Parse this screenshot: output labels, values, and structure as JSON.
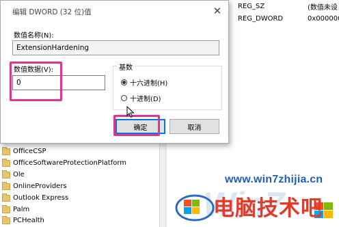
{
  "dialog": {
    "title": "编辑 DWORD (32 位)值",
    "name_label": "数值名称(N):",
    "name_value": "ExtensionHardening",
    "data_label": "数值数据(V):",
    "data_value": "0",
    "base_label": "基数",
    "radio_hex": "十六进制(H)",
    "radio_dec": "十进制(D)",
    "selected_base": "hex",
    "ok_label": "确定",
    "cancel_label": "取消"
  },
  "tree": {
    "items": [
      "OfficeCSP",
      "OfficeSoftwareProtectionPlatform",
      "Ole",
      "OnlineProviders",
      "Outlook Express",
      "Palm",
      "PCHealth"
    ]
  },
  "values": {
    "rows": [
      {
        "type": "REG_SZ",
        "data": "(数值未设"
      },
      {
        "type": "REG_DWORD",
        "data": "0x000000"
      }
    ]
  },
  "watermark": {
    "url": "www.win7zhijia.cn",
    "brand": "电脑技术吧"
  },
  "colors": {
    "highlight": "#e0358f",
    "focus_border": "#0078d7",
    "brand_red": "#e23b2b",
    "brand_blue": "#1f5fb8"
  }
}
